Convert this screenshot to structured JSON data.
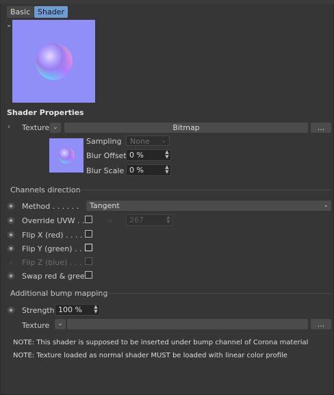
{
  "tabs": [
    {
      "label": "Basic",
      "active": false
    },
    {
      "label": "Shader",
      "active": true
    }
  ],
  "colors": {
    "accent": "#6f9bd1",
    "preview_bg": "#8f8ff7"
  },
  "section_title": "Shader Properties",
  "texture": {
    "label": "Texture",
    "button_label": "Bitmap",
    "more_label": "..."
  },
  "sampling": {
    "label": "Sampling",
    "value": "None"
  },
  "blur_offset": {
    "label": "Blur Offset",
    "value": "0 %"
  },
  "blur_scale": {
    "label": "Blur Scale",
    "value": "0 %"
  },
  "channels": {
    "title": "Channels direction",
    "method": {
      "label": "Method . . . . . .",
      "value": "Tangent"
    },
    "override_uvw": {
      "label": "Override UVW . .",
      "value": "267",
      "checked": false
    },
    "flip_x": {
      "label": "Flip X (red) . . . .",
      "checked": false
    },
    "flip_y": {
      "label": "Flip Y (green) . . .",
      "checked": false
    },
    "flip_z": {
      "label": "Flip Z (blue) . . . .",
      "checked": false
    },
    "swap": {
      "label": "Swap red & green",
      "checked": false
    }
  },
  "bump": {
    "title": "Additional bump mapping",
    "strength": {
      "label": "Strength",
      "value": "100 %"
    },
    "texture_label": "Texture",
    "more_label": "..."
  },
  "notes": [
    "NOTE: This shader is supposed to be inserted under bump channel of Corona material",
    "NOTE: Texture loaded as normal shader MUST be loaded with linear color profile"
  ]
}
